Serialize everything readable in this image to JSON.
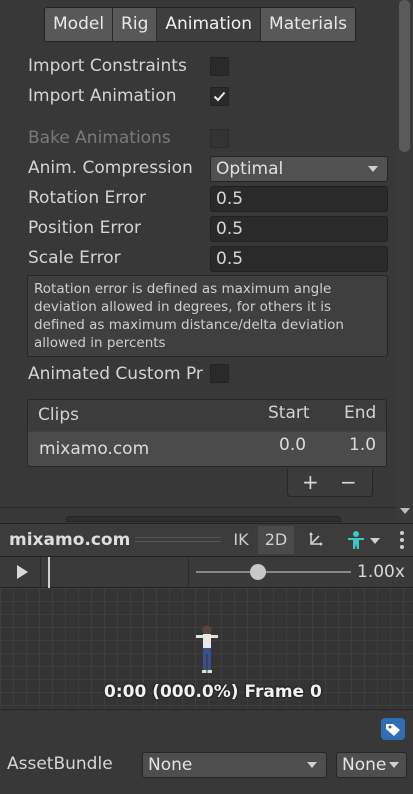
{
  "tabs": [
    {
      "label": "Model",
      "active": false
    },
    {
      "label": "Rig",
      "active": false
    },
    {
      "label": "Animation",
      "active": true
    },
    {
      "label": "Materials",
      "active": false
    }
  ],
  "import_constraints": {
    "label": "Import Constraints",
    "checked": false
  },
  "import_animation": {
    "label": "Import Animation",
    "checked": true
  },
  "bake_animations": {
    "label": "Bake Animations",
    "checked": false,
    "disabled": true
  },
  "anim_compression": {
    "label": "Anim. Compression",
    "value": "Optimal"
  },
  "rotation_error": {
    "label": "Rotation Error",
    "value": "0.5"
  },
  "position_error": {
    "label": "Position Error",
    "value": "0.5"
  },
  "scale_error": {
    "label": "Scale Error",
    "value": "0.5"
  },
  "help_text": "Rotation error is defined as maximum angle deviation allowed in degrees, for others it is defined as maximum distance/delta deviation allowed in percents",
  "animated_custom": {
    "label": "Animated Custom Pr",
    "checked": false
  },
  "clips": {
    "headers": {
      "name": "Clips",
      "start": "Start",
      "end": "End"
    },
    "rows": [
      {
        "name": "mixamo.com",
        "start": "0.0",
        "end": "1.0"
      }
    ],
    "add_label": "+",
    "remove_label": "−"
  },
  "preview": {
    "title": "mixamo.com",
    "ik_label": "IK",
    "twod_label": "2D",
    "speed": "1.00x",
    "speed_fraction": 0.4,
    "time_readout": "0:00 (000.0%) Frame 0"
  },
  "asset_bundle": {
    "label": "AssetBundle",
    "value": "None",
    "variant": "None"
  },
  "colors": {
    "accent_icon": "#3ec6c6",
    "tag_icon": "#2f6db5"
  }
}
